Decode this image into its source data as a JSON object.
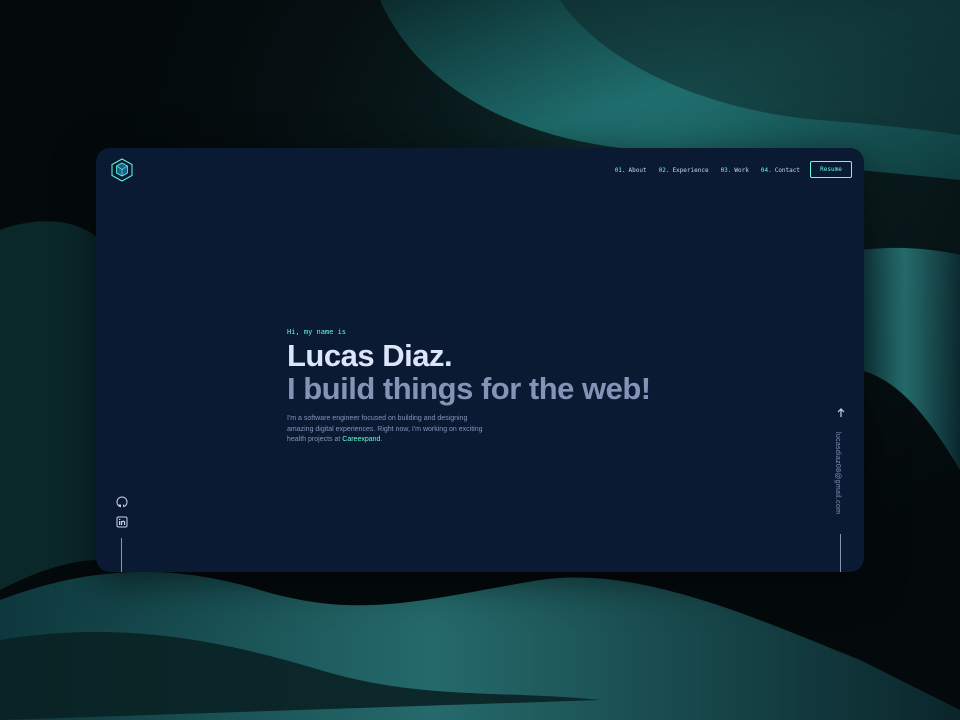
{
  "header": {
    "logo_icon": "cube-logo-icon",
    "nav": [
      {
        "num": "01.",
        "label": "About"
      },
      {
        "num": "02.",
        "label": "Experience"
      },
      {
        "num": "03.",
        "label": "Work"
      },
      {
        "num": "04.",
        "label": "Contact"
      }
    ],
    "resume_label": "Resume"
  },
  "hero": {
    "greeting": "Hi, my name is",
    "name": "Lucas Diaz.",
    "tagline": "I build things for the web!",
    "bio_text": "I'm a software engineer focused on building and designing amazing digital experiences. Right now, I'm working on exciting health projects at ",
    "bio_link": "Careexpand",
    "bio_end": "."
  },
  "social": {
    "icons": [
      "github-icon",
      "linkedin-icon"
    ]
  },
  "side": {
    "email": "lucasdiaz08@gmail.com",
    "arrow_icon": "arrow-up-icon"
  },
  "colors": {
    "accent": "#64ffda",
    "card_bg": "#0b1a33",
    "heading": "#dde5f8",
    "muted": "#8394b8"
  }
}
